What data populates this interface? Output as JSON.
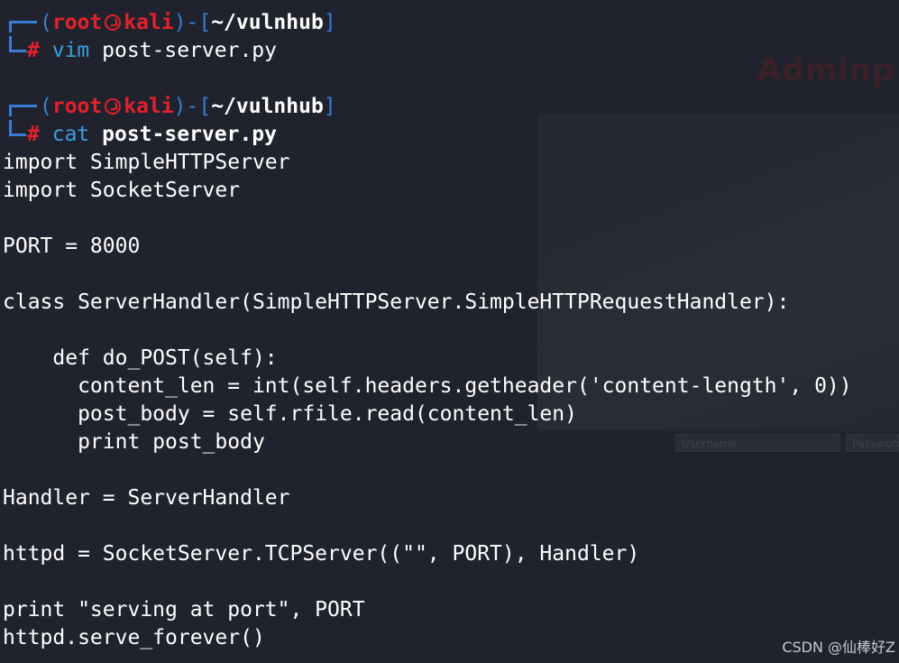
{
  "background": {
    "logo_text": "Adminp",
    "username_placeholder": "Username",
    "password_placeholder": "Password"
  },
  "prompts": [
    {
      "user": "root",
      "host": "kali",
      "path": "~/vulnhub",
      "symbol": "#",
      "command": "vim",
      "argument": "post-server.py"
    },
    {
      "user": "root",
      "host": "kali",
      "path": "~/vulnhub",
      "symbol": "#",
      "command": "cat",
      "argument": "post-server.py"
    }
  ],
  "file_output": [
    "import SimpleHTTPServer",
    "import SocketServer",
    "",
    "PORT = 8000",
    "",
    "class ServerHandler(SimpleHTTPServer.SimpleHTTPRequestHandler):",
    "",
    "    def do_POST(self):",
    "      content_len = int(self.headers.getheader('content-length', 0))",
    "      post_body = self.rfile.read(content_len)",
    "      print post_body",
    "",
    "Handler = ServerHandler",
    "",
    "httpd = SocketServer.TCPServer((\"\", PORT), Handler)",
    "",
    "print \"serving at port\", PORT",
    "httpd.serve_forever()"
  ],
  "watermark": "CSDN @仙棒好Z",
  "colors": {
    "background": "#20232d",
    "prompt_bracket": "#3a7dd4",
    "prompt_user": "#e4202b",
    "command": "#3aa0e0",
    "text": "#ffffff"
  }
}
